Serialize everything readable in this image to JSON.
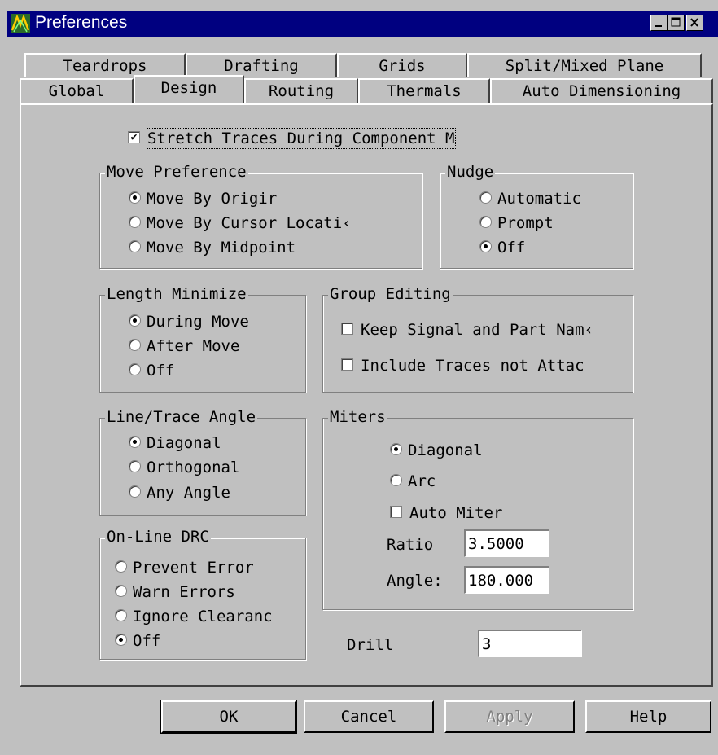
{
  "window": {
    "title": "Preferences"
  },
  "tabs": {
    "row1": [
      "Teardrops",
      "Drafting",
      "Grids",
      "Split/Mixed Plane"
    ],
    "row2": [
      "Global",
      "Design",
      "Routing",
      "Thermals",
      "Auto Dimensioning"
    ],
    "active": "Design"
  },
  "stretch_traces": {
    "label": "Stretch Traces During Component M",
    "checked": true
  },
  "move_preference": {
    "title": "Move Preference",
    "options": [
      "Move By Origir",
      "Move By Cursor Locati‹",
      "Move By Midpoint"
    ],
    "selected": 0
  },
  "nudge": {
    "title": "Nudge",
    "options": [
      "Automatic",
      "Prompt",
      "Off"
    ],
    "selected": 2
  },
  "length_minimize": {
    "title": "Length Minimize",
    "options": [
      "During Move",
      "After Move",
      "Off"
    ],
    "selected": 0
  },
  "group_editing": {
    "title": "Group Editing",
    "options": [
      {
        "label": "Keep Signal and Part Nam‹",
        "checked": false
      },
      {
        "label": "Include Traces not Attac",
        "checked": false
      }
    ]
  },
  "line_trace_angle": {
    "title": "Line/Trace Angle",
    "options": [
      "Diagonal",
      "Orthogonal",
      "Any Angle"
    ],
    "selected": 0
  },
  "miters": {
    "title": "Miters",
    "options": [
      "Diagonal",
      "Arc"
    ],
    "selected": 0,
    "auto_miter": {
      "label": "Auto Miter",
      "checked": false
    },
    "ratio": {
      "label": "Ratio",
      "value": "3.5000"
    },
    "angle": {
      "label": "Angle:",
      "value": "180.000"
    }
  },
  "online_drc": {
    "title": "On-Line DRC",
    "options": [
      "Prevent Error",
      "Warn Errors",
      "Ignore Clearanc",
      "Off"
    ],
    "selected": 3
  },
  "drill": {
    "label": "Drill",
    "value": "3"
  },
  "buttons": {
    "ok": "OK",
    "cancel": "Cancel",
    "apply": "Apply",
    "help": "Help"
  },
  "icons": {
    "app": "pads-logo-icon",
    "minimize": "minimize-icon",
    "maximize": "maximize-icon",
    "close": "close-icon"
  },
  "colors": {
    "titlebar": "#000080",
    "face": "#c0c0c0"
  }
}
